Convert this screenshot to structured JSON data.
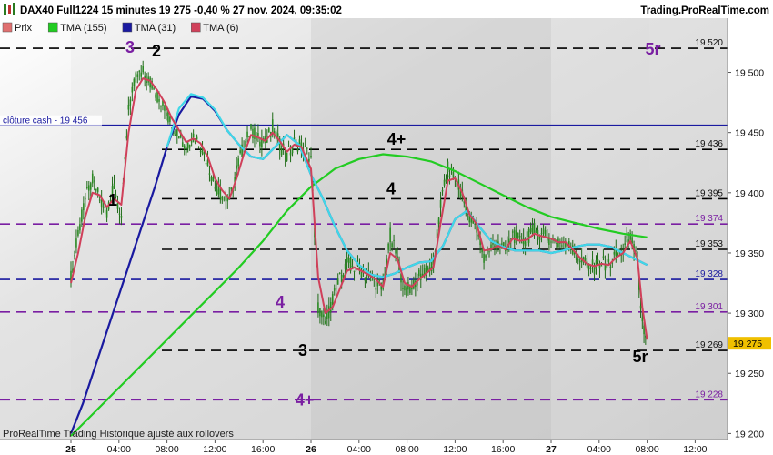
{
  "header": {
    "title": "DAX40 Full1224 15 minutes 19 275 -0,40 % 27 nov. 2024, 09:35:02",
    "source": "Trading.ProRealTime.com"
  },
  "legend": [
    {
      "label": "Prix",
      "color": "#e07070",
      "icon": "candle-icon"
    },
    {
      "label": "TMA (155)",
      "color": "#22cc22"
    },
    {
      "label": "TMA (31)",
      "color": "#1a1aa0"
    },
    {
      "label": "TMA (6)",
      "color": "#d0405a"
    }
  ],
  "footer_note": "ProRealTime Trading  Historique ajusté aux rollovers",
  "chart_data": {
    "type": "line",
    "title": "DAX40 Full1224 15 minutes",
    "ylim": [
      19195,
      19545
    ],
    "y_ticks": [
      {
        "value": 19200,
        "label": "19 200"
      },
      {
        "value": 19250,
        "label": "19 250"
      },
      {
        "value": 19300,
        "label": "19 300"
      },
      {
        "value": 19350,
        "label": "19 350"
      },
      {
        "value": 19400,
        "label": "19 400"
      },
      {
        "value": 19450,
        "label": "19 450"
      },
      {
        "value": 19500,
        "label": "19 500"
      }
    ],
    "x_ticks": [
      {
        "label": "25",
        "bold": true
      },
      {
        "label": "04:00"
      },
      {
        "label": "08:00"
      },
      {
        "label": "12:00"
      },
      {
        "label": "16:00"
      },
      {
        "label": "26",
        "bold": true
      },
      {
        "label": "04:00"
      },
      {
        "label": "08:00"
      },
      {
        "label": "12:00"
      },
      {
        "label": "16:00"
      },
      {
        "label": "27",
        "bold": true
      },
      {
        "label": "04:00"
      },
      {
        "label": "08:00"
      },
      {
        "label": "12:00"
      }
    ],
    "sessions": [
      {
        "label": "25",
        "start": 0.0,
        "end": 1.0
      },
      {
        "label": "26",
        "start": 1.0,
        "end": 2.0
      },
      {
        "label": "27",
        "start": 2.0,
        "end": 2.41
      }
    ],
    "levels": [
      {
        "value": 19520,
        "label": "19 520",
        "color": "#000000",
        "marker": "5r",
        "marker_color": "#7a1fa2",
        "style": "dashed"
      },
      {
        "value": 19456,
        "label": "clôture cash -  19 456",
        "color": "#1a1aa0",
        "style": "solid"
      },
      {
        "value": 19436,
        "label": "19 436",
        "color": "#000000",
        "marker": "4+",
        "marker_color": "#000000",
        "style": "dashed"
      },
      {
        "value": 19395,
        "label": "19 395",
        "color": "#000000",
        "marker": "4",
        "marker_color": "#000000",
        "style": "dashed"
      },
      {
        "value": 19374,
        "label": "19 374",
        "color": "#7a1fa2",
        "style": "dashed"
      },
      {
        "value": 19353,
        "label": "19 353",
        "color": "#000000",
        "style": "dashed"
      },
      {
        "value": 19328,
        "label": "19 328",
        "color": "#1a1aa0",
        "style": "dashed"
      },
      {
        "value": 19301,
        "label": "19 301",
        "color": "#7a1fa2",
        "marker": "4",
        "marker_color": "#7a1fa2",
        "style": "dashed"
      },
      {
        "value": 19269,
        "label": "19 269",
        "color": "#000000",
        "marker": "3",
        "marker_color": "#000000",
        "style": "dashed"
      },
      {
        "value": 19228,
        "label": "19 228",
        "color": "#7a1fa2",
        "marker": "4+",
        "marker_color": "#7a1fa2",
        "style": "dashed"
      }
    ],
    "annotations": [
      {
        "text": "3",
        "color": "#7a1fa2"
      },
      {
        "text": "2",
        "color": "#000000"
      },
      {
        "text": "1",
        "color": "#000000"
      },
      {
        "text": "5r",
        "color": "#000000"
      }
    ],
    "last_price": {
      "value": 19275,
      "label": "19 275",
      "color": "#f0c000"
    },
    "series": [
      {
        "name": "Prix",
        "color": "#2a7a20",
        "x": [
          0.0,
          0.03,
          0.06,
          0.09,
          0.12,
          0.15,
          0.18,
          0.21,
          0.24,
          0.27,
          0.3,
          0.33,
          0.36,
          0.39,
          0.42,
          0.45,
          0.48,
          0.51,
          0.54,
          0.57,
          0.6,
          0.63,
          0.66,
          0.69,
          0.72,
          0.75,
          0.78,
          0.81,
          0.84,
          0.87,
          0.9,
          0.93,
          0.96,
          1.0,
          1.03,
          1.06,
          1.09,
          1.12,
          1.15,
          1.18,
          1.21,
          1.24,
          1.27,
          1.3,
          1.33,
          1.36,
          1.39,
          1.42,
          1.45,
          1.48,
          1.51,
          1.54,
          1.57,
          1.6,
          1.63,
          1.66,
          1.69,
          1.72,
          1.75,
          1.78,
          1.81,
          1.84,
          1.87,
          1.9,
          1.93,
          1.96,
          2.0,
          2.03,
          2.06,
          2.09,
          2.12,
          2.15,
          2.18,
          2.21,
          2.24,
          2.27,
          2.3,
          2.33,
          2.36,
          2.38,
          2.4
        ],
        "values": [
          19330,
          19365,
          19395,
          19410,
          19395,
          19385,
          19405,
          19380,
          19470,
          19495,
          19500,
          19492,
          19480,
          19472,
          19455,
          19450,
          19438,
          19448,
          19440,
          19425,
          19405,
          19398,
          19392,
          19420,
          19440,
          19452,
          19445,
          19442,
          19455,
          19440,
          19430,
          19442,
          19438,
          19430,
          19305,
          19290,
          19312,
          19328,
          19342,
          19338,
          19335,
          19330,
          19325,
          19320,
          19365,
          19345,
          19318,
          19322,
          19330,
          19335,
          19340,
          19390,
          19420,
          19412,
          19398,
          19378,
          19372,
          19345,
          19355,
          19358,
          19352,
          19365,
          19360,
          19362,
          19370,
          19365,
          19362,
          19358,
          19360,
          19352,
          19345,
          19340,
          19338,
          19342,
          19340,
          19348,
          19352,
          19365,
          19340,
          19292,
          19270
        ]
      },
      {
        "name": "TMA (155)",
        "color": "#22cc22",
        "x": [
          0.0,
          0.1,
          0.2,
          0.3,
          0.4,
          0.5,
          0.6,
          0.7,
          0.8,
          0.9,
          1.0,
          1.1,
          1.2,
          1.3,
          1.4,
          1.5,
          1.6,
          1.7,
          1.8,
          1.9,
          2.0,
          2.1,
          2.2,
          2.3,
          2.4
        ],
        "values": [
          19198,
          19218,
          19238,
          19258,
          19278,
          19298,
          19318,
          19338,
          19360,
          19385,
          19405,
          19420,
          19428,
          19432,
          19430,
          19426,
          19418,
          19408,
          19398,
          19388,
          19380,
          19375,
          19370,
          19366,
          19363
        ]
      },
      {
        "name": "TMA (31)",
        "color": "#1a1aa0",
        "x": [
          0.0,
          0.05,
          0.1,
          0.15,
          0.2,
          0.25,
          0.3,
          0.35,
          0.4,
          0.45,
          0.5,
          0.55,
          0.6,
          0.65,
          0.7,
          0.75,
          0.8,
          0.85,
          0.9,
          0.95,
          1.0,
          1.05,
          1.1,
          1.15,
          1.2,
          1.25,
          1.3,
          1.35,
          1.4,
          1.45,
          1.5,
          1.55,
          1.6,
          1.65,
          1.7,
          1.75,
          1.8,
          1.85,
          1.9,
          1.95,
          2.0,
          2.05,
          2.1,
          2.15,
          2.2,
          2.25,
          2.3,
          2.35,
          2.4
        ],
        "values": [
          19200,
          19225,
          19255,
          19285,
          19315,
          19345,
          19375,
          19405,
          19438,
          19465,
          19480,
          19478,
          19468,
          19452,
          19440,
          19430,
          19428,
          19438,
          19448,
          19440,
          19415,
          19395,
          19372,
          19352,
          19340,
          19332,
          19330,
          19333,
          19338,
          19342,
          19343,
          19356,
          19378,
          19385,
          19372,
          19360,
          19355,
          19352,
          19352,
          19352,
          19350,
          19352,
          19355,
          19357,
          19357,
          19355,
          19350,
          19345,
          19340
        ]
      },
      {
        "name": "TMA (6)",
        "color": "#d0405a",
        "x": [
          0.0,
          0.03,
          0.06,
          0.09,
          0.12,
          0.15,
          0.18,
          0.21,
          0.24,
          0.27,
          0.3,
          0.33,
          0.36,
          0.39,
          0.42,
          0.45,
          0.48,
          0.51,
          0.54,
          0.57,
          0.6,
          0.63,
          0.66,
          0.69,
          0.72,
          0.75,
          0.78,
          0.81,
          0.84,
          0.87,
          0.9,
          0.93,
          0.96,
          1.0,
          1.03,
          1.06,
          1.09,
          1.12,
          1.15,
          1.18,
          1.21,
          1.24,
          1.27,
          1.3,
          1.33,
          1.36,
          1.39,
          1.42,
          1.45,
          1.48,
          1.51,
          1.54,
          1.57,
          1.6,
          1.63,
          1.66,
          1.69,
          1.72,
          1.75,
          1.78,
          1.81,
          1.84,
          1.87,
          1.9,
          1.93,
          1.96,
          2.0,
          2.03,
          2.06,
          2.09,
          2.12,
          2.15,
          2.18,
          2.21,
          2.24,
          2.27,
          2.3,
          2.33,
          2.36,
          2.38,
          2.4
        ],
        "values": [
          19325,
          19350,
          19380,
          19400,
          19398,
          19388,
          19395,
          19390,
          19450,
          19485,
          19495,
          19493,
          19485,
          19475,
          19462,
          19452,
          19442,
          19445,
          19441,
          19430,
          19412,
          19402,
          19395,
          19412,
          19432,
          19448,
          19446,
          19443,
          19450,
          19443,
          19434,
          19440,
          19438,
          19420,
          19330,
          19300,
          19305,
          19320,
          19335,
          19338,
          19335,
          19332,
          19328,
          19322,
          19350,
          19345,
          19325,
          19322,
          19328,
          19333,
          19338,
          19375,
          19410,
          19412,
          19400,
          19382,
          19374,
          19352,
          19353,
          19356,
          19353,
          19362,
          19360,
          19361,
          19366,
          19364,
          19362,
          19359,
          19359,
          19353,
          19346,
          19341,
          19339,
          19341,
          19340,
          19346,
          19350,
          19360,
          19345,
          19305,
          19278
        ]
      },
      {
        "name": "TMA (31) cyan",
        "color": "#40d8e8",
        "x": [
          0.4,
          0.45,
          0.5,
          0.55,
          0.6,
          0.65,
          0.7,
          0.75,
          0.8,
          0.85,
          0.9,
          0.95,
          1.0,
          1.05,
          1.1,
          1.15,
          1.2,
          1.25,
          1.3,
          1.35,
          1.4,
          1.45,
          1.5,
          1.55,
          1.6,
          1.65,
          1.7,
          1.75,
          1.8,
          1.85,
          1.9,
          1.95,
          2.0,
          2.05,
          2.1,
          2.15,
          2.2,
          2.25,
          2.3,
          2.35,
          2.4
        ],
        "values": [
          19438,
          19470,
          19482,
          19479,
          19469,
          19452,
          19440,
          19430,
          19428,
          19438,
          19448,
          19440,
          19415,
          19395,
          19372,
          19352,
          19340,
          19332,
          19330,
          19333,
          19338,
          19342,
          19343,
          19356,
          19378,
          19385,
          19372,
          19360,
          19355,
          19352,
          19352,
          19352,
          19350,
          19352,
          19355,
          19357,
          19357,
          19355,
          19350,
          19345,
          19340
        ]
      }
    ]
  }
}
